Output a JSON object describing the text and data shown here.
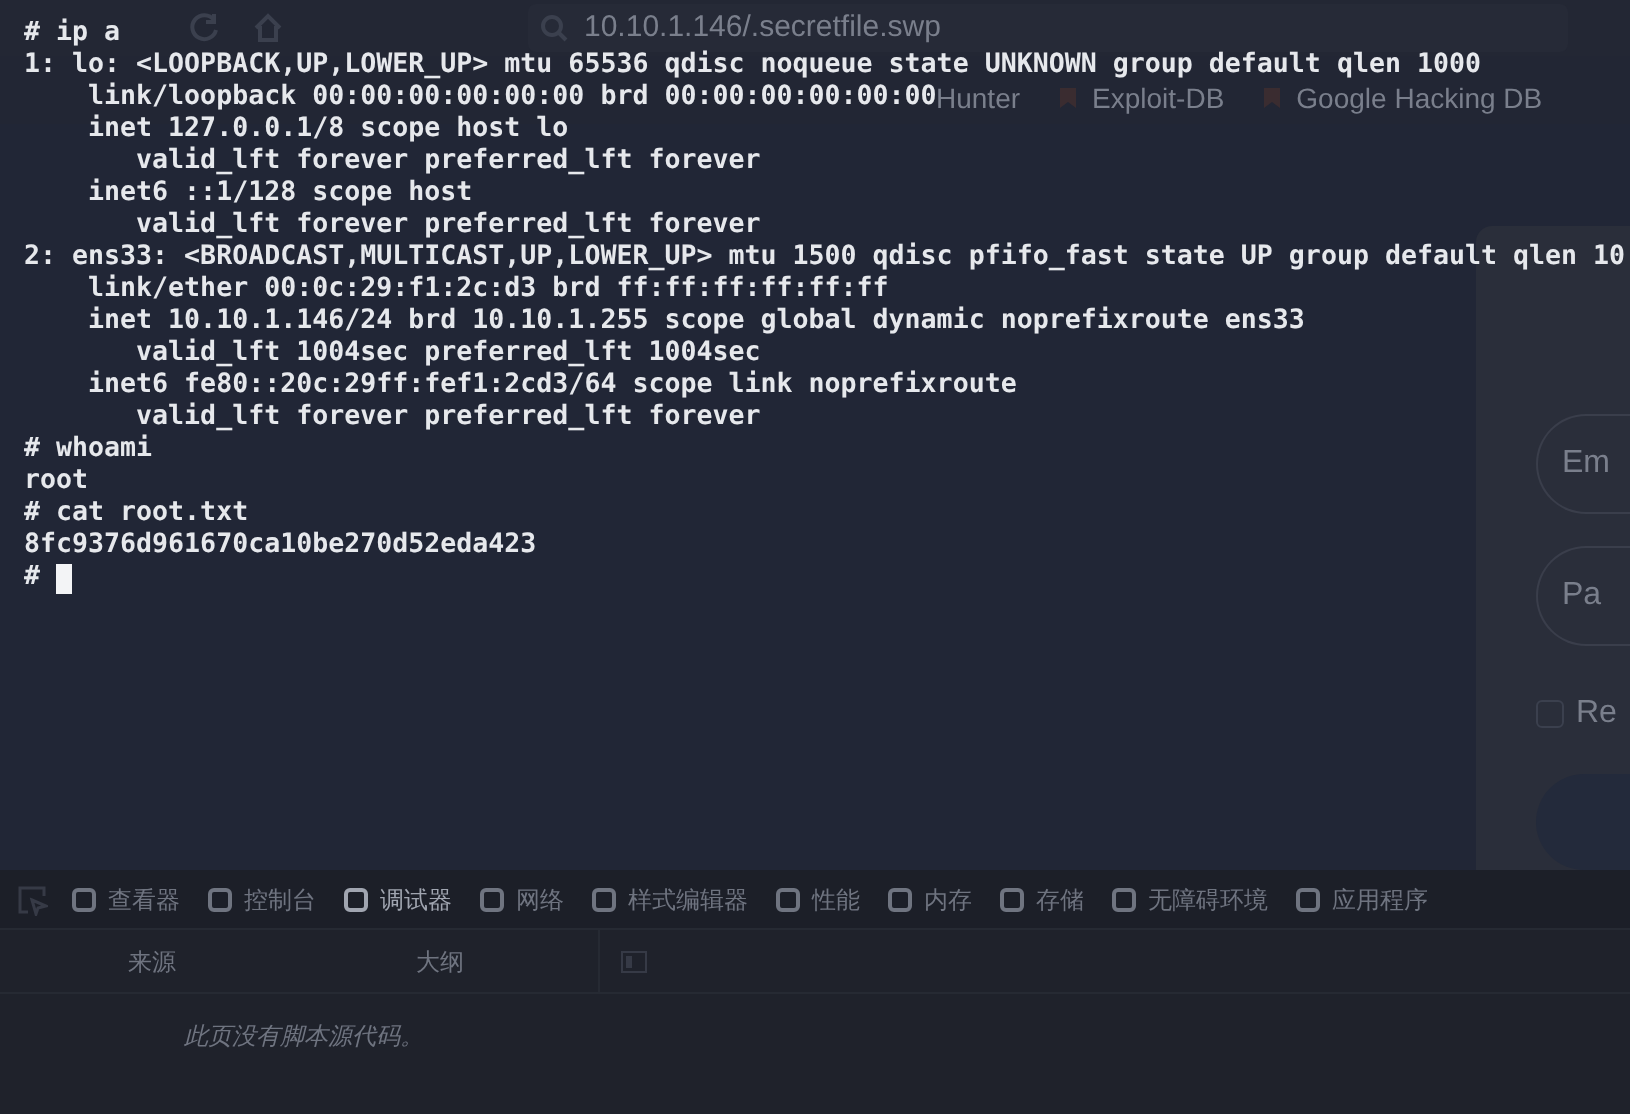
{
  "browser": {
    "address": "10.10.1.146/.secretfile.swp",
    "bookmarks": [
      {
        "label": "Hunter"
      },
      {
        "label": "Exploit-DB"
      },
      {
        "label": "Google Hacking DB"
      }
    ],
    "login": {
      "fields": [
        {
          "placeholder": "Em"
        },
        {
          "placeholder": "Pa"
        }
      ],
      "remember": {
        "label": "Re",
        "checked": false
      }
    },
    "devtools": {
      "tabs": [
        {
          "label": "查看器",
          "selected": false
        },
        {
          "label": "控制台",
          "selected": false
        },
        {
          "label": "调试器",
          "selected": true
        },
        {
          "label": "网络",
          "selected": false
        },
        {
          "label": "样式编辑器",
          "selected": false
        },
        {
          "label": "性能",
          "selected": false
        },
        {
          "label": "内存",
          "selected": false
        },
        {
          "label": "存储",
          "selected": false
        },
        {
          "label": "无障碍环境",
          "selected": false
        },
        {
          "label": "应用程序",
          "selected": false
        }
      ],
      "panes": [
        "来源",
        "大纲"
      ],
      "message": "此页没有脚本源代码。"
    }
  },
  "terminal": {
    "lines": [
      "# ip a",
      "1: lo: <LOOPBACK,UP,LOWER_UP> mtu 65536 qdisc noqueue state UNKNOWN group default qlen 1000",
      "    link/loopback 00:00:00:00:00:00 brd 00:00:00:00:00:00",
      "    inet 127.0.0.1/8 scope host lo",
      "       valid_lft forever preferred_lft forever",
      "    inet6 ::1/128 scope host",
      "       valid_lft forever preferred_lft forever",
      "2: ens33: <BROADCAST,MULTICAST,UP,LOWER_UP> mtu 1500 qdisc pfifo_fast state UP group default qlen 10",
      "    link/ether 00:0c:29:f1:2c:d3 brd ff:ff:ff:ff:ff:ff",
      "    inet 10.10.1.146/24 brd 10.10.1.255 scope global dynamic noprefixroute ens33",
      "       valid_lft 1004sec preferred_lft 1004sec",
      "    inet6 fe80::20c:29ff:fef1:2cd3/64 scope link noprefixroute",
      "       valid_lft forever preferred_lft forever",
      "# whoami",
      "root",
      "# cat root.txt",
      "8fc9376d961670ca10be270d52eda423"
    ],
    "prompt": "#",
    "cursor": true
  }
}
